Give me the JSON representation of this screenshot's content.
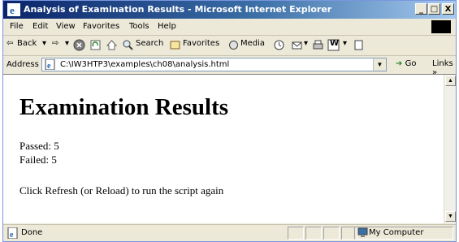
{
  "window": {
    "title": "Analysis of Examination Results - Microsoft Internet Explorer",
    "controls": {
      "minimize": "_",
      "maximize": "□",
      "close": "X"
    }
  },
  "menu": [
    "File",
    "Edit",
    "View",
    "Favorites",
    "Tools",
    "Help"
  ],
  "toolbar": {
    "back_label": "Back",
    "search_label": "Search",
    "favorites_label": "Favorites",
    "media_label": "Media",
    "word_label": "W"
  },
  "address": {
    "label": "Address",
    "url": "C:\\IW3HTP3\\examples\\ch08\\analysis.html",
    "go_label": "Go",
    "links_label": "Links »"
  },
  "page": {
    "heading": "Examination Results",
    "passed": "Passed: 5",
    "failed": "Failed: 5",
    "instruction": "Click Refresh (or Reload) to run the script again"
  },
  "status": {
    "text": "Done",
    "zone": "My Computer"
  }
}
